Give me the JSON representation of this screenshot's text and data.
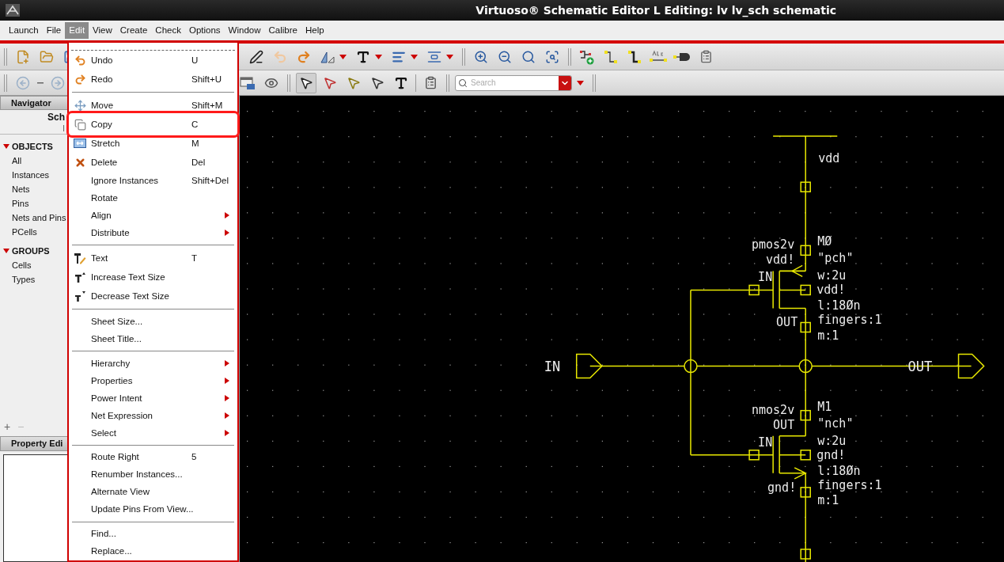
{
  "window": {
    "title": "Virtuoso® Schematic Editor L Editing: lv lv_sch schematic"
  },
  "menu_bar": [
    {
      "label": "Launch",
      "selected": false
    },
    {
      "label": "File",
      "selected": false
    },
    {
      "label": "Edit",
      "selected": true
    },
    {
      "label": "View",
      "selected": false
    },
    {
      "label": "Create",
      "selected": false
    },
    {
      "label": "Check",
      "selected": false
    },
    {
      "label": "Options",
      "selected": false
    },
    {
      "label": "Window",
      "selected": false
    },
    {
      "label": "Calibre",
      "selected": false
    },
    {
      "label": "Help",
      "selected": false
    }
  ],
  "toolbar": {
    "search": {
      "placeholder": "Search"
    }
  },
  "navigator": {
    "title": "Navigator",
    "heading": "Sch",
    "subheading": "I",
    "groups": [
      {
        "label": "OBJECTS",
        "expanded": true,
        "children": [
          {
            "label": "All"
          },
          {
            "label": "Instances"
          },
          {
            "label": "Nets"
          },
          {
            "label": "Pins"
          },
          {
            "label": "Nets and Pins"
          },
          {
            "label": "PCells"
          }
        ]
      },
      {
        "label": "GROUPS",
        "expanded": true,
        "children": [
          {
            "label": "Cells"
          },
          {
            "label": "Types"
          }
        ]
      }
    ],
    "add": "+",
    "remove": "−"
  },
  "property_editor": {
    "title": "Property Edi"
  },
  "edit_menu": [
    {
      "kind": "tearoff"
    },
    {
      "kind": "item",
      "label": "Undo",
      "shortcut": "U",
      "submenu": false,
      "highlighted": false
    },
    {
      "kind": "item",
      "label": "Redo",
      "shortcut": "Shift+U",
      "submenu": false,
      "highlighted": false
    },
    {
      "kind": "separator"
    },
    {
      "kind": "item",
      "label": "Move",
      "shortcut": "Shift+M",
      "submenu": false,
      "highlighted": false
    },
    {
      "kind": "item",
      "label": "Copy",
      "shortcut": "C",
      "submenu": false,
      "highlighted": true
    },
    {
      "kind": "item",
      "label": "Stretch",
      "shortcut": "M",
      "submenu": false,
      "highlighted": false
    },
    {
      "kind": "item",
      "label": "Delete",
      "shortcut": "Del",
      "submenu": false,
      "highlighted": false
    },
    {
      "kind": "item",
      "label": "Ignore Instances",
      "shortcut": "Shift+Del",
      "submenu": false,
      "highlighted": false
    },
    {
      "kind": "item",
      "label": "Rotate",
      "submenu": false,
      "highlighted": false
    },
    {
      "kind": "item",
      "label": "Align",
      "submenu": true,
      "highlighted": false
    },
    {
      "kind": "item",
      "label": "Distribute",
      "submenu": true,
      "highlighted": false
    },
    {
      "kind": "separator"
    },
    {
      "kind": "item",
      "label": "Text",
      "shortcut": "T",
      "submenu": false,
      "highlighted": false
    },
    {
      "kind": "item",
      "label": "Increase Text Size",
      "submenu": false,
      "highlighted": false
    },
    {
      "kind": "item",
      "label": "Decrease Text Size",
      "submenu": false,
      "highlighted": false
    },
    {
      "kind": "separator"
    },
    {
      "kind": "item",
      "label": "Sheet Size...",
      "submenu": false,
      "highlighted": false
    },
    {
      "kind": "item",
      "label": "Sheet Title...",
      "submenu": false,
      "highlighted": false
    },
    {
      "kind": "separator"
    },
    {
      "kind": "item",
      "label": "Hierarchy",
      "submenu": true,
      "highlighted": false
    },
    {
      "kind": "item",
      "label": "Properties",
      "submenu": true,
      "highlighted": false
    },
    {
      "kind": "item",
      "label": "Power Intent",
      "submenu": true,
      "highlighted": false
    },
    {
      "kind": "item",
      "label": "Net Expression",
      "submenu": true,
      "highlighted": false
    },
    {
      "kind": "item",
      "label": "Select",
      "submenu": true,
      "highlighted": false
    },
    {
      "kind": "separator"
    },
    {
      "kind": "item",
      "label": "Route Right",
      "shortcut": "5",
      "submenu": false,
      "highlighted": false
    },
    {
      "kind": "item",
      "label": "Renumber Instances...",
      "submenu": false,
      "highlighted": false
    },
    {
      "kind": "item",
      "label": "Alternate View",
      "submenu": false,
      "highlighted": false
    },
    {
      "kind": "item",
      "label": "Update Pins From View...",
      "submenu": false,
      "highlighted": false
    },
    {
      "kind": "separator"
    },
    {
      "kind": "item",
      "label": "Find...",
      "submenu": false,
      "highlighted": false
    },
    {
      "kind": "item",
      "label": "Replace...",
      "submenu": false,
      "highlighted": false
    }
  ],
  "schematic": {
    "supply": "vdd",
    "input_pin": "IN",
    "output_pin": "OUT",
    "transistors": [
      {
        "kind": "pmos",
        "cell": "pmos2v",
        "left_top": "vdd!",
        "gate": "IN",
        "left_bottom": "OUT",
        "properties": [
          "MØ",
          "\"pch\"",
          "w:2u",
          "vdd!",
          "l:18Øn",
          "fingers:1",
          "m:1"
        ]
      },
      {
        "kind": "nmos",
        "cell": "nmos2v",
        "left_top": "OUT",
        "gate": "IN",
        "left_bottom": "gnd!",
        "properties": [
          "M1",
          "\"nch\"",
          "w:2u",
          "gnd!",
          "l:18Øn",
          "fingers:1",
          "m:1"
        ]
      }
    ]
  }
}
